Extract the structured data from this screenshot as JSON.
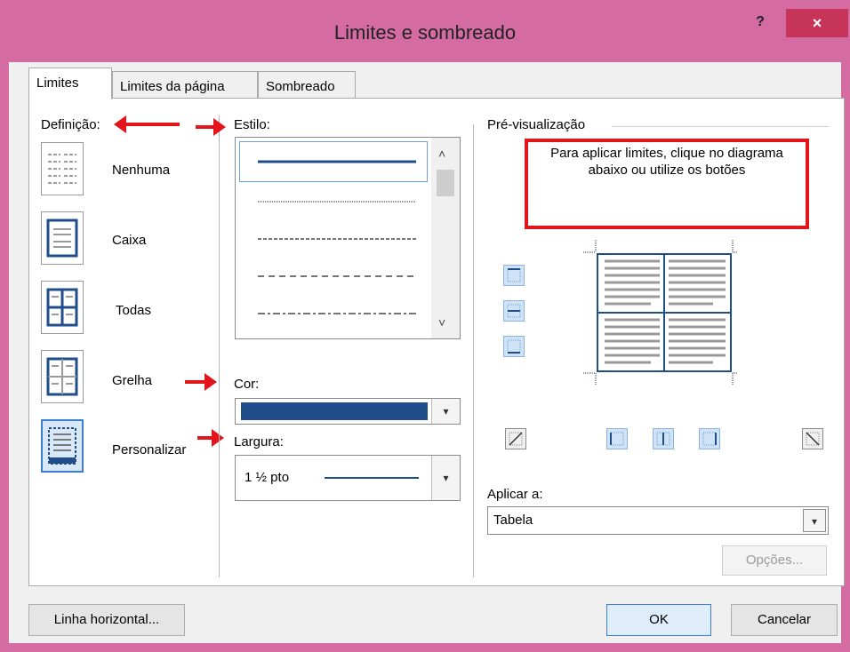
{
  "window": {
    "title": "Limites e sombreado",
    "help_label": "?",
    "close_label": "×"
  },
  "tabs": [
    {
      "label": "Limites",
      "active": true
    },
    {
      "label": "Limites da página",
      "active": false
    },
    {
      "label": "Sombreado",
      "active": false
    }
  ],
  "definicao": {
    "label": "Definição:",
    "presets": [
      {
        "label": "Nenhuma",
        "icon": "border-none-icon",
        "selected": false
      },
      {
        "label": "Caixa",
        "icon": "border-box-icon",
        "selected": false
      },
      {
        "label": "Todas",
        "icon": "border-all-icon",
        "selected": false
      },
      {
        "label": "Grelha",
        "icon": "border-grid-icon",
        "selected": false
      },
      {
        "label": "Personalizar",
        "icon": "border-custom-icon",
        "selected": true
      }
    ]
  },
  "estilo": {
    "label": "Estilo:",
    "styles": [
      "solid",
      "dotted",
      "dashed-short",
      "dashed-long",
      "dash-dot"
    ]
  },
  "cor": {
    "label": "Cor:",
    "value_color": "#1f4e8a"
  },
  "largura": {
    "label": "Largura:",
    "value": "1 ½ pto"
  },
  "preview": {
    "label": "Pré-visualização",
    "instructions": "Para aplicar limites, clique no diagrama abaixo ou utilize os botões"
  },
  "aplicar": {
    "label": "Aplicar a:",
    "value": "Tabela"
  },
  "buttons": {
    "options": "Opções...",
    "horizontal_line": "Linha horizontal...",
    "ok": "OK",
    "cancel": "Cancelar"
  },
  "colors": {
    "titlebar": "#d46ba2",
    "close_bg": "#c7345a",
    "accent": "#3c7fd0",
    "annotation_red": "#e3141a"
  }
}
